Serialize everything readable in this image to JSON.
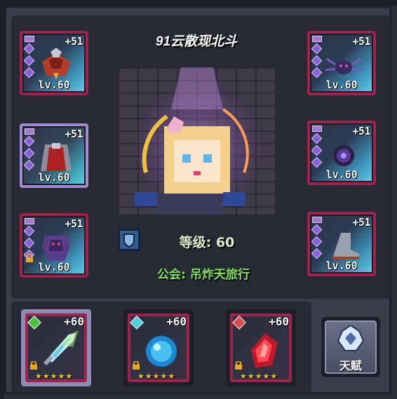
{
  "player": {
    "name": "91云散现北斗",
    "level_text": "等级: 60",
    "guild_text": "公会: 吊炸天旅行"
  },
  "equipment_left": [
    {
      "plus": "+51",
      "level": "lv.60",
      "item": "crimson-helmet-icon",
      "locked": false
    },
    {
      "plus": "+51",
      "level": "lv.60",
      "item": "red-cape-icon",
      "locked": false
    },
    {
      "plus": "+51",
      "level": "lv.60",
      "item": "shadow-armor-icon",
      "locked": true
    }
  ],
  "equipment_right": [
    {
      "plus": "+51",
      "level": "lv.60",
      "item": "spider-pet-icon",
      "locked": false
    },
    {
      "plus": "+51",
      "level": "lv.60",
      "item": "void-orb-icon",
      "locked": false
    },
    {
      "plus": "+51",
      "level": "lv.60",
      "item": "steel-boots-icon",
      "locked": false
    }
  ],
  "weapons": [
    {
      "plus": "+60",
      "stars": "★★★★★",
      "item": "ice-sword-icon"
    },
    {
      "plus": "+60",
      "stars": "★★★★★",
      "item": "water-orb-icon"
    },
    {
      "plus": "+60",
      "stars": "★★★★★",
      "item": "fire-crystal-icon"
    }
  ],
  "talent": {
    "label": "天赋"
  },
  "colors": {
    "panel": "#262a34",
    "rarity_border": "#a1224a",
    "guild_green": "#7ee05a",
    "star_gold": "#f0c020"
  }
}
